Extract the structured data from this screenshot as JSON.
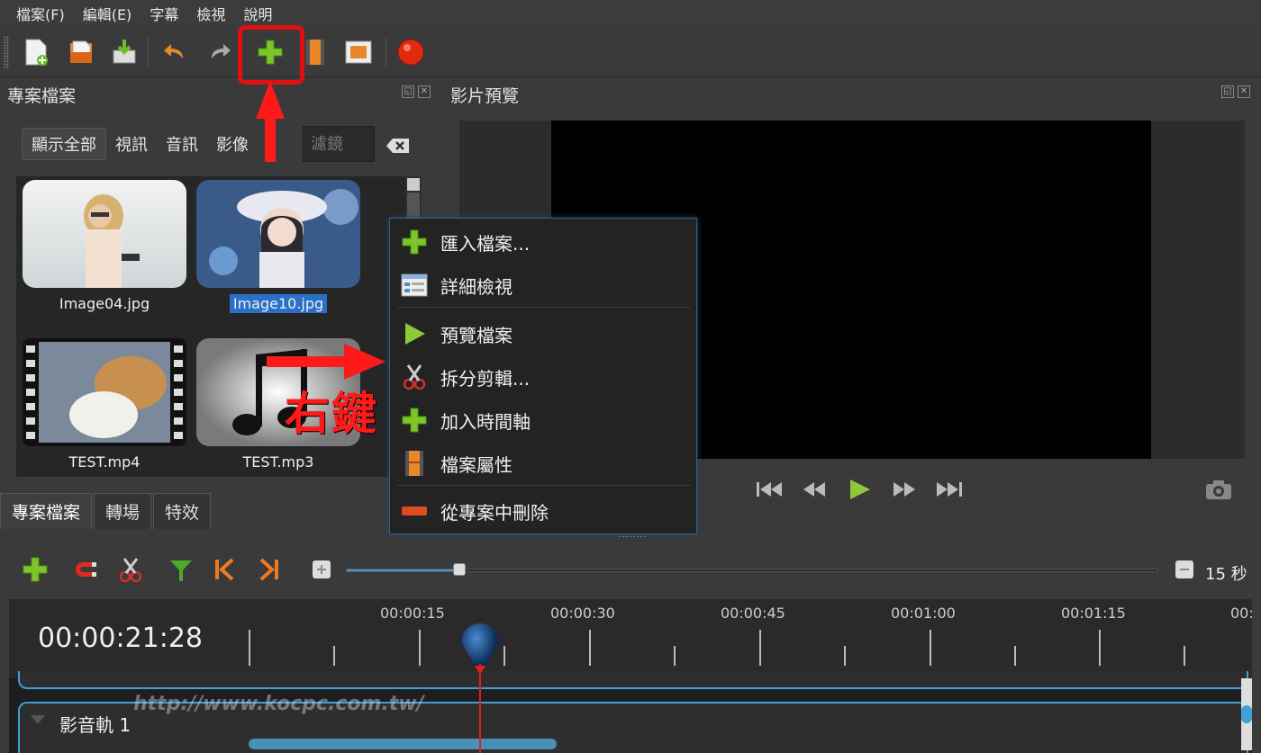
{
  "menu": [
    "檔案(F)",
    "編輯(E)",
    "字幕",
    "檢視",
    "說明"
  ],
  "toolbar": {
    "buttons": [
      "new-project-icon",
      "open-project-icon",
      "save-project-icon",
      "undo-icon",
      "redo-icon",
      "import-files-icon",
      "choose-profile-icon",
      "fullscreen-icon",
      "export-video-icon"
    ]
  },
  "project_panel": {
    "title": "專案檔案",
    "filters": [
      "顯示全部",
      "視訊",
      "音訊",
      "影像"
    ],
    "filter_placeholder": "濾鏡",
    "files": [
      {
        "name": "Image04.jpg",
        "selected": false
      },
      {
        "name": "Image10.jpg",
        "selected": true
      },
      {
        "name": "TEST.mp4",
        "selected": false
      },
      {
        "name": "TEST.mp3",
        "selected": false
      }
    ]
  },
  "preview_panel": {
    "title": "影片預覽"
  },
  "bottom_tabs": [
    "專案檔案",
    "轉場",
    "特效"
  ],
  "context_menu": {
    "items": [
      {
        "label": "匯入檔案...",
        "icon": "plus-icon"
      },
      {
        "label": "詳細檢視",
        "icon": "details-view-icon"
      },
      {
        "label": "預覽檔案",
        "icon": "play-icon"
      },
      {
        "label": "拆分剪輯...",
        "icon": "scissors-icon"
      },
      {
        "label": "加入時間軸",
        "icon": "plus-icon"
      },
      {
        "label": "檔案屬性",
        "icon": "film-icon"
      },
      {
        "label": "從專案中刪除",
        "icon": "remove-icon"
      }
    ]
  },
  "annotation": {
    "text": "右鍵",
    "color": "#ff1a1a"
  },
  "timeline": {
    "timecode": "00:00:21:28",
    "zoom_label": "15 秒",
    "zoom_fraction": 0.14,
    "ruler_labels": [
      "00:00:15",
      "00:00:30",
      "00:00:45",
      "00:01:00",
      "00:01:15",
      "00:"
    ],
    "track_name": "影音軌 1"
  },
  "watermark": "http://www.kocpc.com.tw/",
  "colors": {
    "accent": "#3fa0d8",
    "highlight": "#e01010",
    "selection": "#2a6fc9"
  }
}
